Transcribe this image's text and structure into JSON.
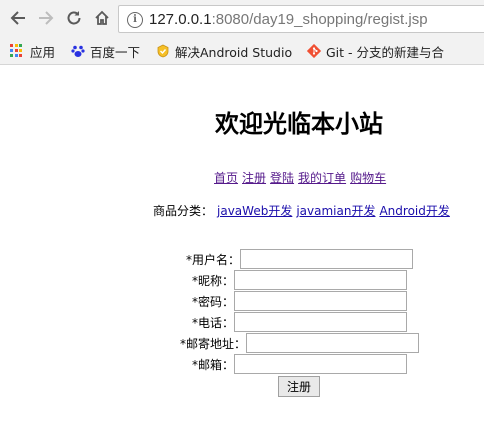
{
  "browser": {
    "url_host": "127.0.0.1",
    "url_rest": ":8080/day19_shopping/regist.jsp"
  },
  "bookmarks": [
    {
      "label": "应用",
      "icon": "apps-grid-icon"
    },
    {
      "label": "百度一下",
      "icon": "baidu-paw-icon"
    },
    {
      "label": "解决Android Studio",
      "icon": "badge-icon"
    },
    {
      "label": "Git - 分支的新建与合",
      "icon": "git-icon"
    }
  ],
  "page": {
    "title": "欢迎光临本小站",
    "nav": [
      "首页",
      "注册",
      "登陆",
      "我的订单",
      "购物车"
    ],
    "category_label": "商品分类：",
    "categories": [
      "javaWeb开发",
      "javamian开发",
      "Android开发"
    ]
  },
  "form": {
    "fields": [
      {
        "label": "*用户名：",
        "value": ""
      },
      {
        "label": "*昵称：",
        "value": ""
      },
      {
        "label": "*密码：",
        "value": ""
      },
      {
        "label": "*电话：",
        "value": ""
      },
      {
        "label": "*邮寄地址：",
        "value": ""
      },
      {
        "label": "*邮箱：",
        "value": ""
      }
    ],
    "submit": "注册"
  },
  "colors": {
    "link": "#1a0dab",
    "visited": "#551a8b",
    "toolbar": "#f2f2f2"
  }
}
